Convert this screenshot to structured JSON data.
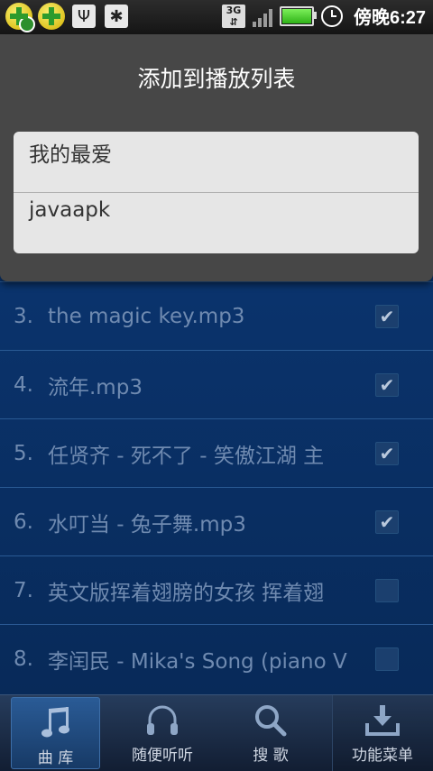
{
  "status_bar": {
    "network": "3G",
    "time": "傍晚6:27",
    "icons": [
      "plus-app-icon",
      "plus-app-icon",
      "usb-icon",
      "debug-bug-icon",
      "3g-icon",
      "signal-icon",
      "battery-icon",
      "alarm-icon"
    ]
  },
  "dialog": {
    "title": "添加到播放列表",
    "items": [
      "我的最爱",
      "javaapk"
    ]
  },
  "songs": [
    {
      "num": "3.",
      "title": "the magic key.mp3",
      "checked": true
    },
    {
      "num": "4.",
      "title": "流年.mp3",
      "checked": true
    },
    {
      "num": "5.",
      "title": "任贤齐 - 死不了 - 笑傲江湖 主",
      "checked": true
    },
    {
      "num": "6.",
      "title": "水叮当 - 兔子舞.mp3",
      "checked": true
    },
    {
      "num": "7.",
      "title": "英文版挥着翅膀的女孩 挥着翅",
      "checked": false
    },
    {
      "num": "8.",
      "title": "李闰民 - Mika's Song (piano V",
      "checked": false
    }
  ],
  "tabs": [
    {
      "label": "曲 库",
      "icon": "music-note-icon",
      "active": true
    },
    {
      "label": "随便听听",
      "icon": "headphones-icon",
      "active": false
    },
    {
      "label": "搜 歌",
      "icon": "search-icon",
      "active": false
    },
    {
      "label": "功能菜单",
      "icon": "download-tray-icon",
      "active": false
    }
  ],
  "colors": {
    "list_bg": "#0b3c7a",
    "dialog_bg": "#474747",
    "dialog_list_bg": "#e6e6e6",
    "battery": "#2fb218"
  }
}
